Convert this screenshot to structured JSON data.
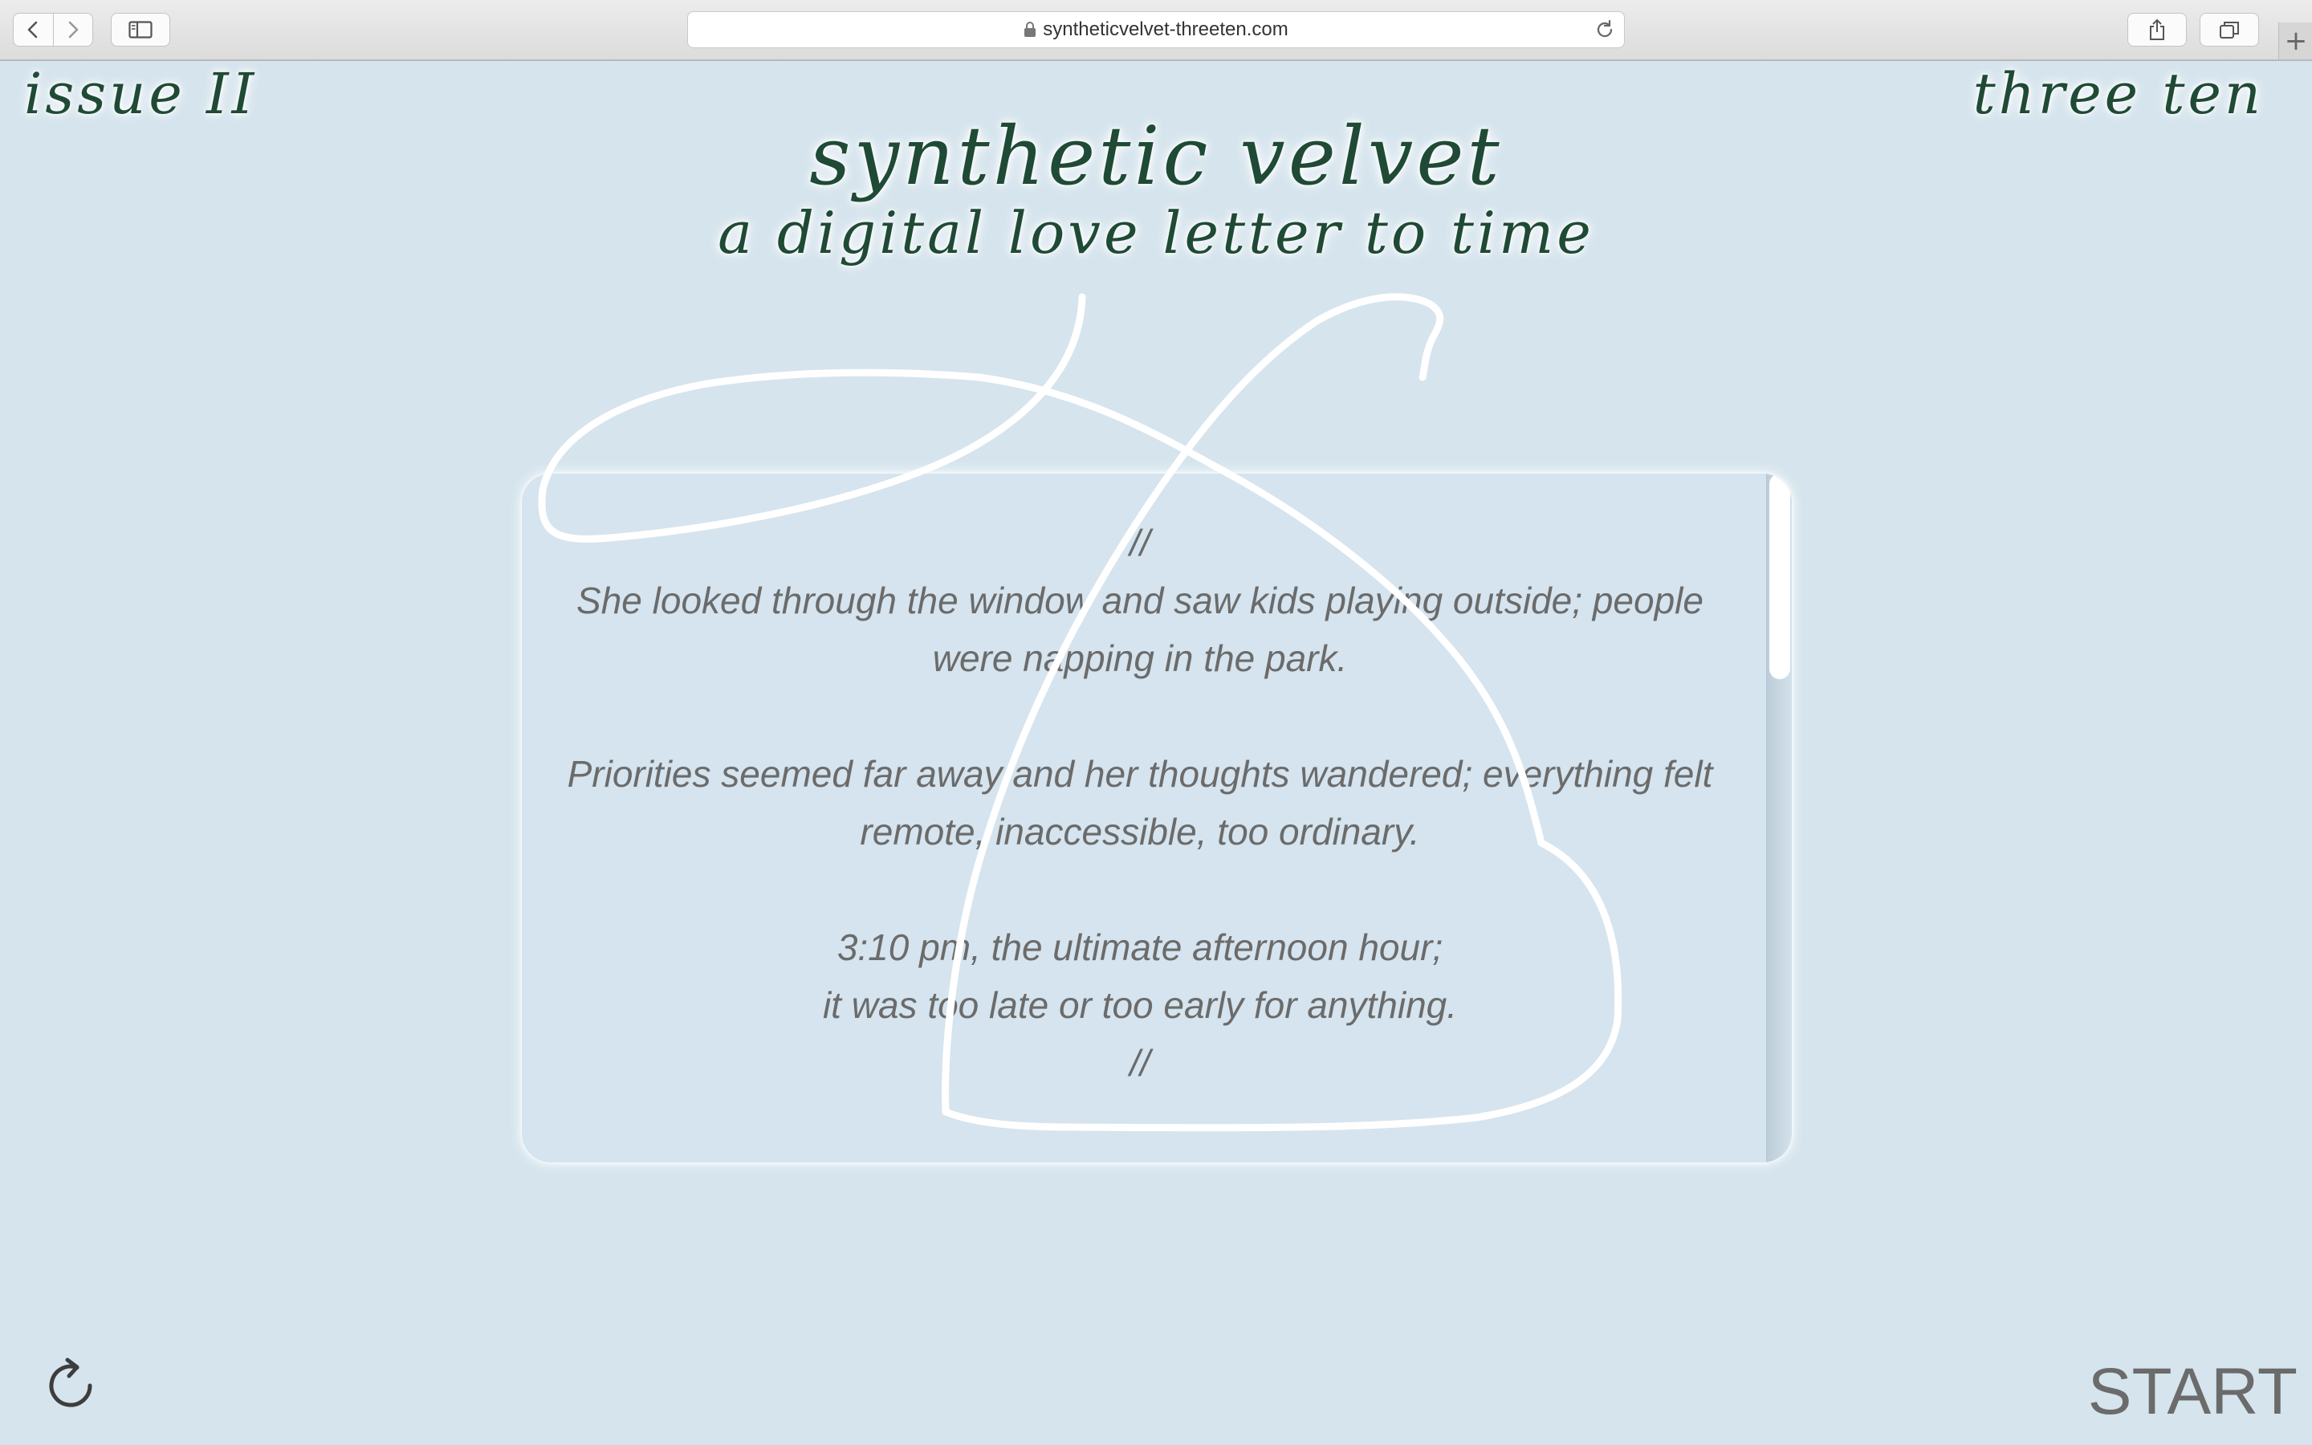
{
  "browser": {
    "url": "syntheticvelvet-threeten.com"
  },
  "page": {
    "issue_label": "issue II",
    "corner_right": "three ten",
    "title": "synthetic velvet",
    "subtitle": "a digital love letter to time",
    "story": {
      "open_mark": "//",
      "para1": "She looked through the window and saw kids playing outside; people were napping in the park.",
      "para2": "Priorities seemed far away and her thoughts wandered; everything felt remote, inaccessible, too ordinary.",
      "para3_line1": "3:10 pm, the ultimate afternoon hour;",
      "para3_line2": "it was too late or too early for anything.",
      "close_mark": "//"
    },
    "start_label": "START"
  },
  "icons": {
    "back": "chevron-left-icon",
    "forward": "chevron-right-icon",
    "sidebar": "sidebar-icon",
    "lock": "lock-icon",
    "reload": "reload-icon",
    "share": "share-icon",
    "tabs": "tabs-icon",
    "new_tab": "plus-icon",
    "restart": "restart-icon"
  },
  "colors": {
    "background": "#d5e4ed",
    "title_green": "#1f4a35",
    "body_text": "#6b6b6b",
    "glow": "#ffffff"
  }
}
